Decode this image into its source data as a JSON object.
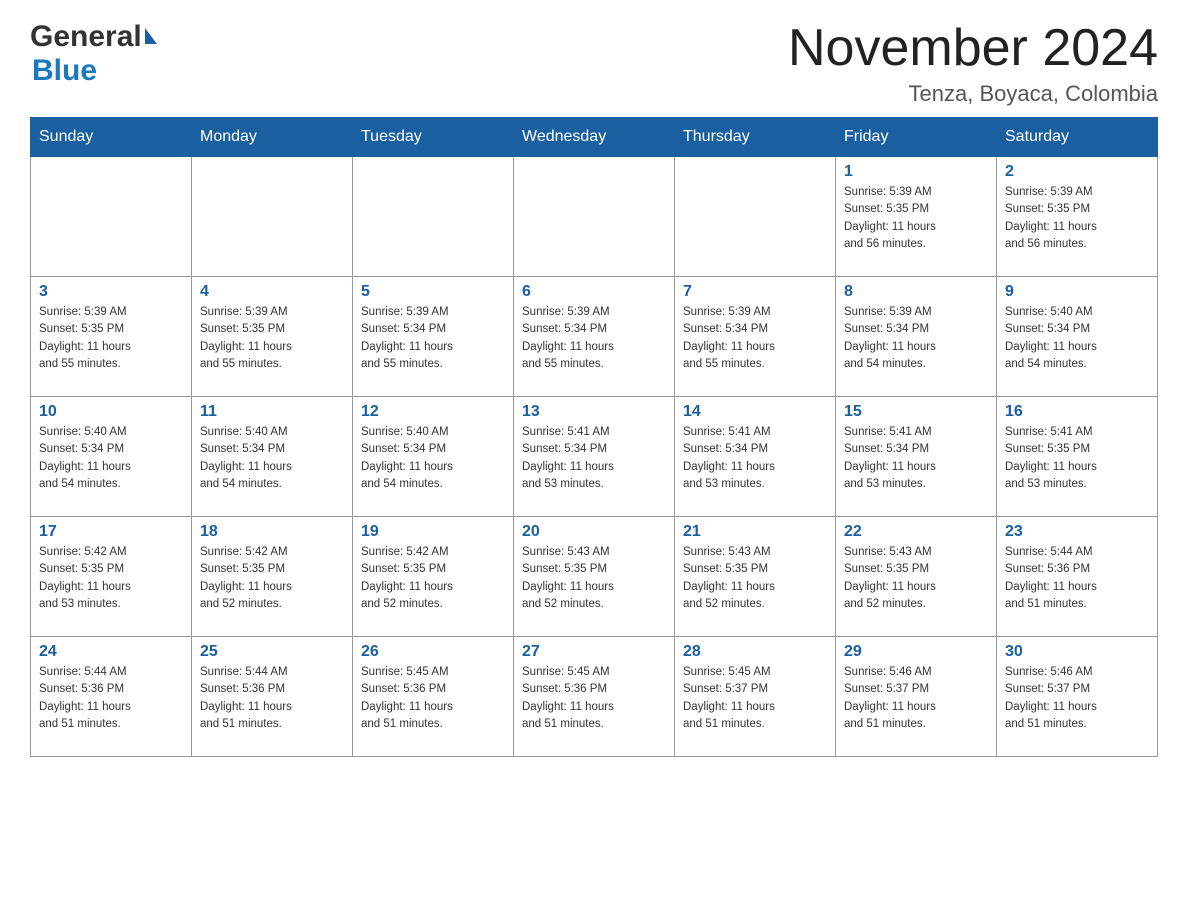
{
  "logo": {
    "general": "General",
    "blue": "Blue"
  },
  "header": {
    "title": "November 2024",
    "location": "Tenza, Boyaca, Colombia"
  },
  "weekdays": [
    "Sunday",
    "Monday",
    "Tuesday",
    "Wednesday",
    "Thursday",
    "Friday",
    "Saturday"
  ],
  "weeks": [
    [
      {
        "day": "",
        "info": ""
      },
      {
        "day": "",
        "info": ""
      },
      {
        "day": "",
        "info": ""
      },
      {
        "day": "",
        "info": ""
      },
      {
        "day": "",
        "info": ""
      },
      {
        "day": "1",
        "info": "Sunrise: 5:39 AM\nSunset: 5:35 PM\nDaylight: 11 hours\nand 56 minutes."
      },
      {
        "day": "2",
        "info": "Sunrise: 5:39 AM\nSunset: 5:35 PM\nDaylight: 11 hours\nand 56 minutes."
      }
    ],
    [
      {
        "day": "3",
        "info": "Sunrise: 5:39 AM\nSunset: 5:35 PM\nDaylight: 11 hours\nand 55 minutes."
      },
      {
        "day": "4",
        "info": "Sunrise: 5:39 AM\nSunset: 5:35 PM\nDaylight: 11 hours\nand 55 minutes."
      },
      {
        "day": "5",
        "info": "Sunrise: 5:39 AM\nSunset: 5:34 PM\nDaylight: 11 hours\nand 55 minutes."
      },
      {
        "day": "6",
        "info": "Sunrise: 5:39 AM\nSunset: 5:34 PM\nDaylight: 11 hours\nand 55 minutes."
      },
      {
        "day": "7",
        "info": "Sunrise: 5:39 AM\nSunset: 5:34 PM\nDaylight: 11 hours\nand 55 minutes."
      },
      {
        "day": "8",
        "info": "Sunrise: 5:39 AM\nSunset: 5:34 PM\nDaylight: 11 hours\nand 54 minutes."
      },
      {
        "day": "9",
        "info": "Sunrise: 5:40 AM\nSunset: 5:34 PM\nDaylight: 11 hours\nand 54 minutes."
      }
    ],
    [
      {
        "day": "10",
        "info": "Sunrise: 5:40 AM\nSunset: 5:34 PM\nDaylight: 11 hours\nand 54 minutes."
      },
      {
        "day": "11",
        "info": "Sunrise: 5:40 AM\nSunset: 5:34 PM\nDaylight: 11 hours\nand 54 minutes."
      },
      {
        "day": "12",
        "info": "Sunrise: 5:40 AM\nSunset: 5:34 PM\nDaylight: 11 hours\nand 54 minutes."
      },
      {
        "day": "13",
        "info": "Sunrise: 5:41 AM\nSunset: 5:34 PM\nDaylight: 11 hours\nand 53 minutes."
      },
      {
        "day": "14",
        "info": "Sunrise: 5:41 AM\nSunset: 5:34 PM\nDaylight: 11 hours\nand 53 minutes."
      },
      {
        "day": "15",
        "info": "Sunrise: 5:41 AM\nSunset: 5:34 PM\nDaylight: 11 hours\nand 53 minutes."
      },
      {
        "day": "16",
        "info": "Sunrise: 5:41 AM\nSunset: 5:35 PM\nDaylight: 11 hours\nand 53 minutes."
      }
    ],
    [
      {
        "day": "17",
        "info": "Sunrise: 5:42 AM\nSunset: 5:35 PM\nDaylight: 11 hours\nand 53 minutes."
      },
      {
        "day": "18",
        "info": "Sunrise: 5:42 AM\nSunset: 5:35 PM\nDaylight: 11 hours\nand 52 minutes."
      },
      {
        "day": "19",
        "info": "Sunrise: 5:42 AM\nSunset: 5:35 PM\nDaylight: 11 hours\nand 52 minutes."
      },
      {
        "day": "20",
        "info": "Sunrise: 5:43 AM\nSunset: 5:35 PM\nDaylight: 11 hours\nand 52 minutes."
      },
      {
        "day": "21",
        "info": "Sunrise: 5:43 AM\nSunset: 5:35 PM\nDaylight: 11 hours\nand 52 minutes."
      },
      {
        "day": "22",
        "info": "Sunrise: 5:43 AM\nSunset: 5:35 PM\nDaylight: 11 hours\nand 52 minutes."
      },
      {
        "day": "23",
        "info": "Sunrise: 5:44 AM\nSunset: 5:36 PM\nDaylight: 11 hours\nand 51 minutes."
      }
    ],
    [
      {
        "day": "24",
        "info": "Sunrise: 5:44 AM\nSunset: 5:36 PM\nDaylight: 11 hours\nand 51 minutes."
      },
      {
        "day": "25",
        "info": "Sunrise: 5:44 AM\nSunset: 5:36 PM\nDaylight: 11 hours\nand 51 minutes."
      },
      {
        "day": "26",
        "info": "Sunrise: 5:45 AM\nSunset: 5:36 PM\nDaylight: 11 hours\nand 51 minutes."
      },
      {
        "day": "27",
        "info": "Sunrise: 5:45 AM\nSunset: 5:36 PM\nDaylight: 11 hours\nand 51 minutes."
      },
      {
        "day": "28",
        "info": "Sunrise: 5:45 AM\nSunset: 5:37 PM\nDaylight: 11 hours\nand 51 minutes."
      },
      {
        "day": "29",
        "info": "Sunrise: 5:46 AM\nSunset: 5:37 PM\nDaylight: 11 hours\nand 51 minutes."
      },
      {
        "day": "30",
        "info": "Sunrise: 5:46 AM\nSunset: 5:37 PM\nDaylight: 11 hours\nand 51 minutes."
      }
    ]
  ]
}
